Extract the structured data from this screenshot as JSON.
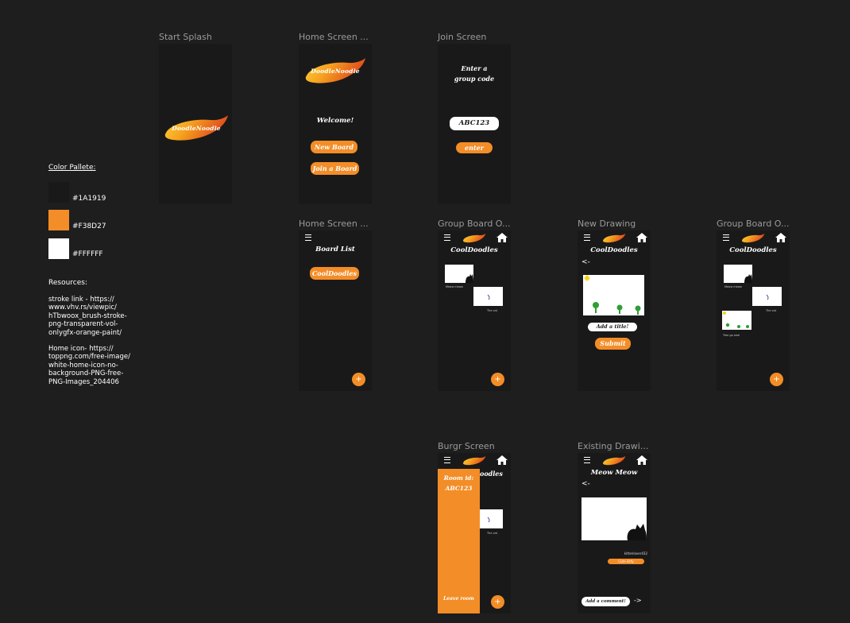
{
  "frames": {
    "start_splash": {
      "label": "Start Splash"
    },
    "home1": {
      "label": "Home Screen ...",
      "welcome": "Welcome!",
      "new_board": "New Board",
      "join_board": "Join a Board"
    },
    "join": {
      "label": "Join Screen",
      "prompt_line1": "Enter a",
      "prompt_line2": "group code",
      "code_value": "ABC123",
      "enter": "enter"
    },
    "home2": {
      "label": "Home Screen ...",
      "board_list": "Board List",
      "board_item": "CoolDoodles",
      "fab": "+"
    },
    "group_board1": {
      "label": "Group Board O...",
      "title": "CoolDoodles",
      "cap1": "Meow meow",
      "cap2": "The cat",
      "fab": "+"
    },
    "new_drawing": {
      "label": "New Drawing",
      "title": "CoolDoodles",
      "back": "<-",
      "title_input": "Add a title!",
      "submit": "Submit"
    },
    "group_board2": {
      "label": "Group Board O...",
      "title": "CoolDoodles",
      "cap1": "Meow meow",
      "cap2": "The cat",
      "cap3": "Tree go wee",
      "fab": "+"
    },
    "burger": {
      "label": "Burgr Screen",
      "partial_title": "oodles",
      "room_line1": "Room id:",
      "room_line2": "ABC123",
      "leave": "Leave room",
      "cap2": "The cat",
      "fab": "+"
    },
    "existing": {
      "label": "Existing Drawi...",
      "title": "Meow Meow",
      "back": "<-",
      "author": "kittenlover432",
      "cute_kitty": "Cute kitty",
      "comment_input": "Add a comment!",
      "send": "->"
    }
  },
  "logo_text": "DoodleNoodle",
  "palette": {
    "title": "Color Pallete:",
    "swatches": [
      {
        "color": "#1A1919",
        "label": "#1A1919"
      },
      {
        "color": "#F38D27",
        "label": "#F38D27"
      },
      {
        "color": "#FFFFFF",
        "label": "#FFFFFF"
      }
    ]
  },
  "resources": {
    "title": "Resources:",
    "stroke": [
      "stroke link - https://",
      "www.vhv.rs/viewpic/",
      "hTbwoox_brush-stroke-",
      "png-transparent-vol-",
      "onlygfx-orange-paint/"
    ],
    "home": [
      "Home icon- https://",
      "toppng.com/free-image/",
      "white-home-icon-no-",
      "background-PNG-free-",
      "PNG-Images_204406"
    ]
  },
  "colors": {
    "bg": "#1e1e1e",
    "frame": "#1A1919",
    "accent": "#F38D27",
    "white": "#FFFFFF"
  }
}
